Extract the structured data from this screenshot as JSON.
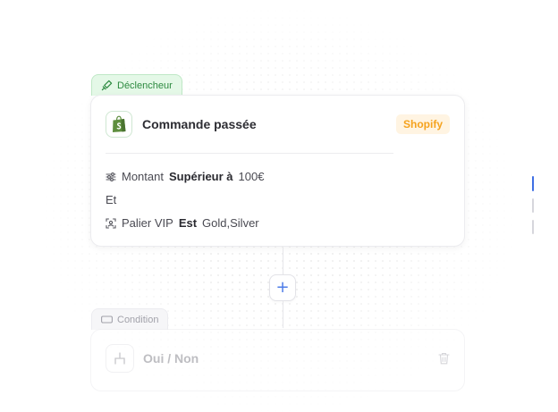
{
  "trigger": {
    "tag_label": "Déclencheur",
    "title": "Commande passée",
    "app_badge": "Shopify",
    "conditions": [
      {
        "field": "Montant",
        "operator": "Supérieur à",
        "value": "100€"
      },
      {
        "joiner": "Et"
      },
      {
        "field": "Palier VIP",
        "operator": "Est",
        "value": "Gold,Silver"
      }
    ]
  },
  "add_step": {
    "label": "+"
  },
  "condition_node": {
    "tag_label": "Condition",
    "title": "Oui / Non"
  },
  "colors": {
    "accent": "#4d7ce8",
    "trigger_green": "#2d8a40",
    "shopify_green": "#5e8e3e",
    "shopify_badge": "#f5a21d"
  },
  "icons": {
    "trigger_tag": "trigger-icon",
    "app_logo": "shopify-bag-icon",
    "condition_row_1": "sliders-icon",
    "condition_row_2": "user-scan-icon",
    "condition_tag": "rectangle-icon",
    "condition_node": "branch-icon",
    "delete": "trash-icon"
  }
}
